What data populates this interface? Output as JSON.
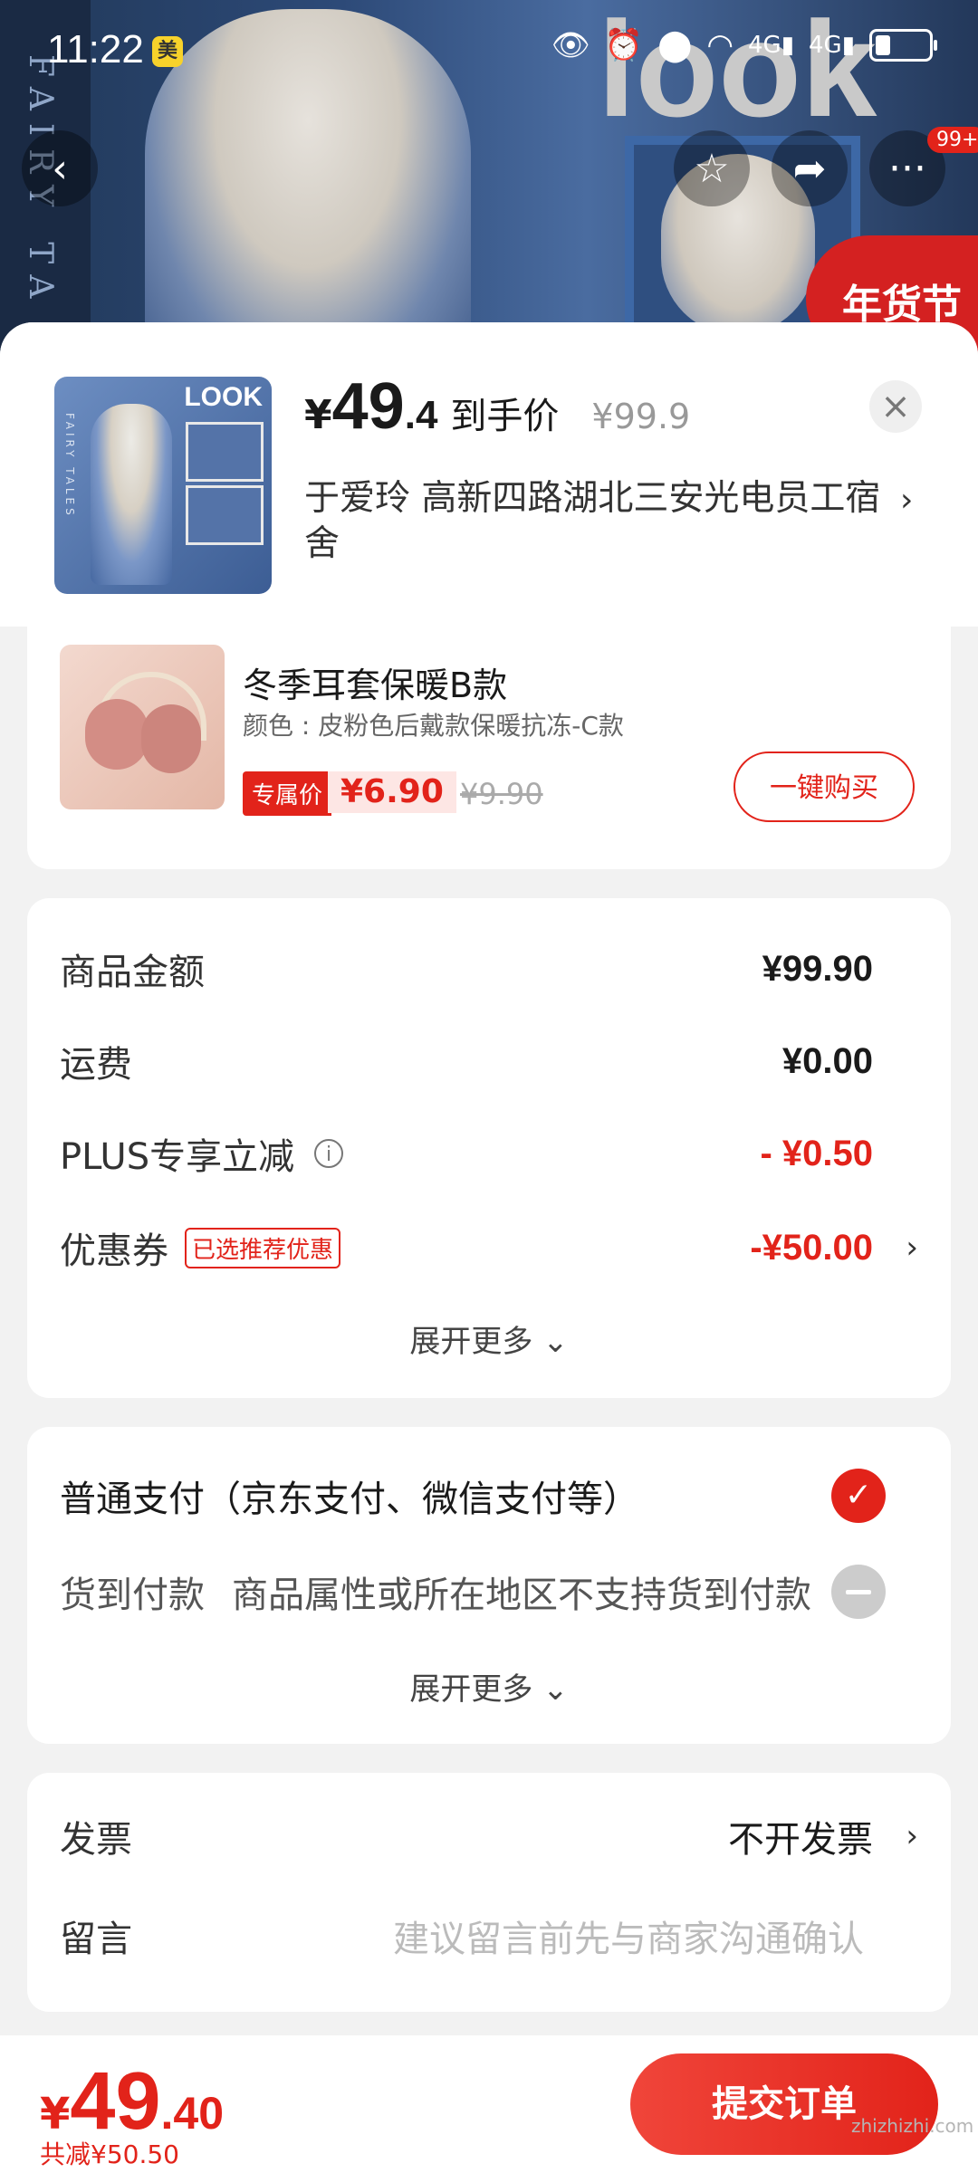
{
  "status": {
    "time": "11:22",
    "app_badge": "美"
  },
  "nav": {
    "cart_badge": "99+"
  },
  "product": {
    "price_yen": "¥",
    "price_int": "49",
    "price_dec": ".4",
    "price_label": "到手价",
    "original_price": "¥99.9",
    "address": "于爱玲  高新四路湖北三安光电员工宿舍"
  },
  "addon": {
    "title": "冬季耳套保暖B款",
    "spec": "颜色 : 皮粉色后戴款保暖抗冻-C款",
    "tag": "专属价",
    "price": "¥6.90",
    "original": "¥9.90",
    "buy_label": "一键购买"
  },
  "fees": {
    "goods_label": "商品金额",
    "goods_value": "¥99.90",
    "ship_label": "运费",
    "ship_value": "¥0.00",
    "plus_label": "PLUS专享立减",
    "plus_value": "- ¥0.50",
    "coupon_label": "优惠券",
    "coupon_tag": "已选推荐优惠",
    "coupon_value": "-¥50.00",
    "expand": "展开更多 ⌄"
  },
  "payment": {
    "normal": "普通支付（京东支付、微信支付等）",
    "cod_label": "货到付款",
    "cod_note": "商品属性或所在地区不支持货到付款",
    "expand": "展开更多 ⌄"
  },
  "invoice": {
    "label": "发票",
    "value": "不开发票",
    "note_label": "留言",
    "note_placeholder": "建议留言前先与商家沟通确认"
  },
  "footer": {
    "total_yen": "¥",
    "total_int": "49",
    "total_dec": ".40",
    "saved": "共减¥50.50",
    "submit": "提交订单",
    "watermark": "zhizhizhi.com"
  }
}
